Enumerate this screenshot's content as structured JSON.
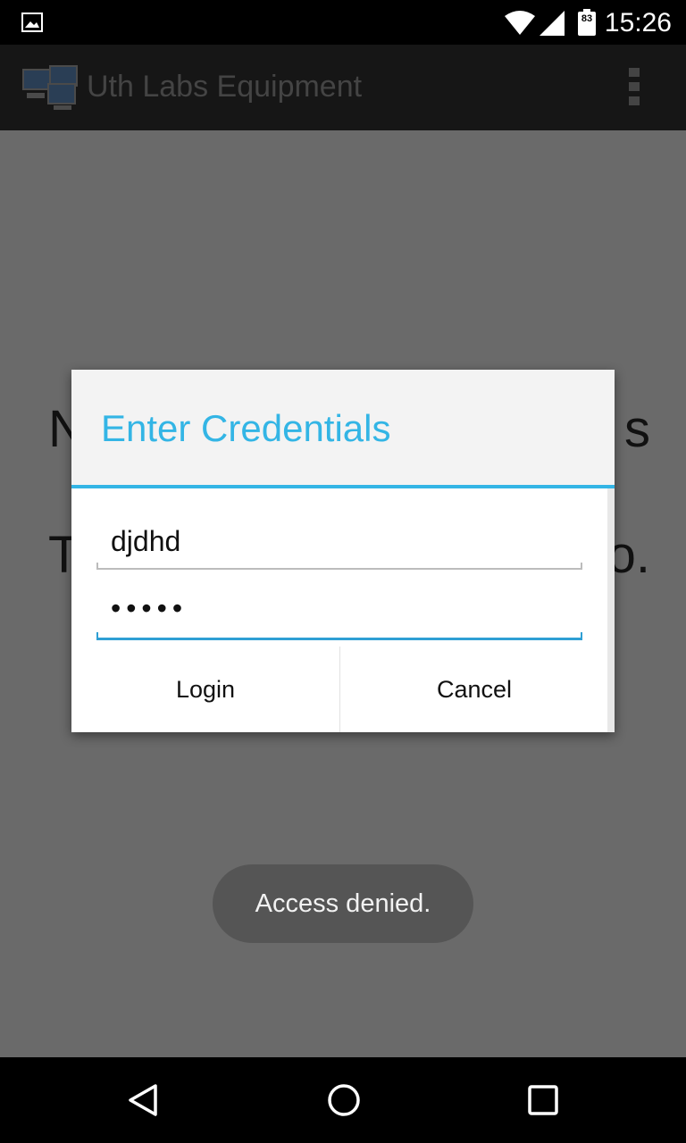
{
  "status_bar": {
    "time": "15:26",
    "battery_level": "83",
    "icons": [
      "gallery-icon",
      "wifi-icon",
      "signal-icon",
      "battery-icon"
    ]
  },
  "action_bar": {
    "title": "Uth Labs Equipment",
    "icons": [
      "app-logo-icon",
      "overflow-menu-icon"
    ]
  },
  "background": {
    "line1_left": "N",
    "line1_right": "s",
    "line2_left": "T",
    "line2_right": "o."
  },
  "dialog": {
    "title": "Enter Credentials",
    "username_value": "djdhd",
    "password_value": "•••••",
    "login_label": "Login",
    "cancel_label": "Cancel"
  },
  "toast": {
    "message": "Access denied."
  },
  "nav_bar": {
    "icons": [
      "back-icon",
      "home-icon",
      "recents-icon"
    ]
  },
  "colors": {
    "accent": "#33b5e5",
    "dim_overlay": "#6a6a6a",
    "toast_bg": "#555555"
  }
}
